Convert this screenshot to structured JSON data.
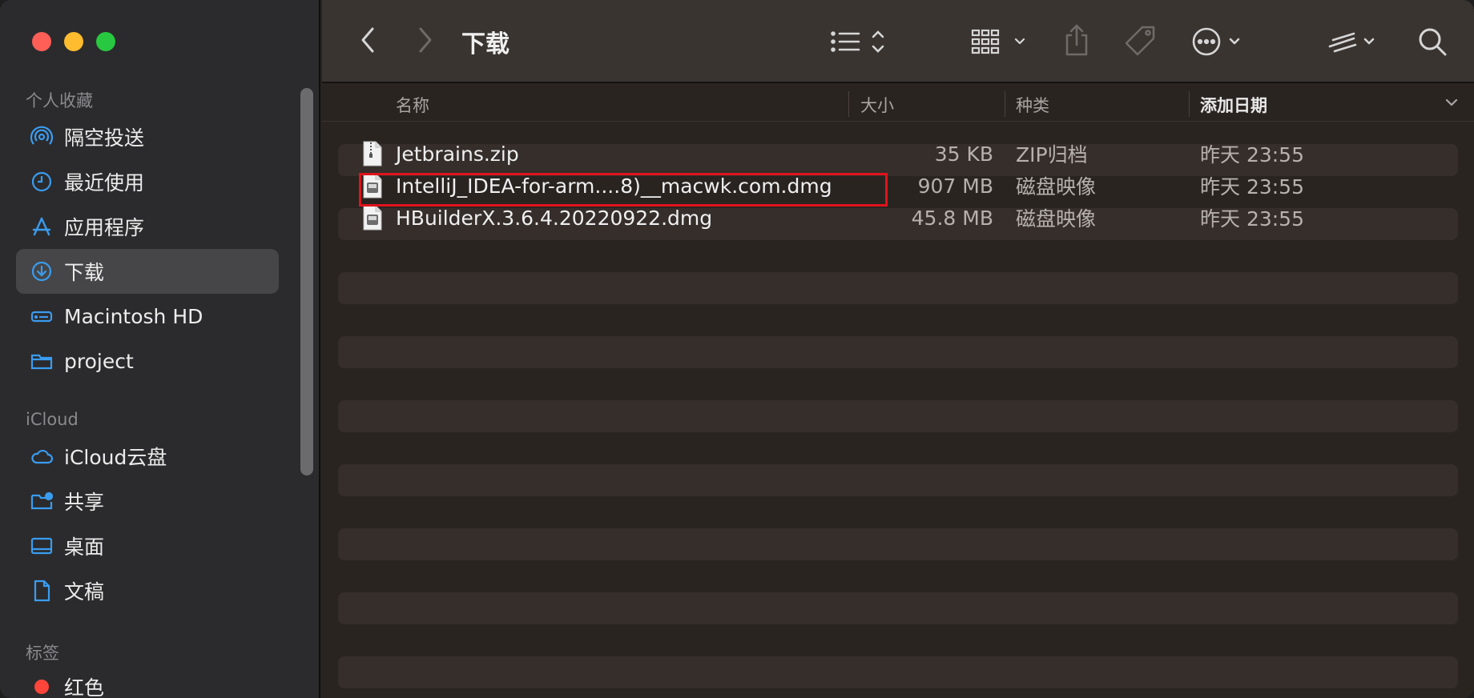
{
  "window": {
    "title": "下载"
  },
  "toolbar": {
    "back_icon": "chevron-left-icon",
    "forward_icon": "chevron-right-icon",
    "view_icon": "list-view-icon",
    "group_icon": "grid-group-icon",
    "share_icon": "share-icon",
    "tag_icon": "tag-icon",
    "more_icon": "ellipsis-circle-icon",
    "extension_icon": "extension-icon",
    "search_icon": "search-icon"
  },
  "sidebar": {
    "favorites_header": "个人收藏",
    "favorites": [
      {
        "label": "隔空投送",
        "icon": "airdrop-icon"
      },
      {
        "label": "最近使用",
        "icon": "clock-icon"
      },
      {
        "label": "应用程序",
        "icon": "applications-icon"
      },
      {
        "label": "下载",
        "icon": "download-icon",
        "active": true
      },
      {
        "label": "Macintosh HD",
        "icon": "hard-drive-icon"
      },
      {
        "label": "project",
        "icon": "folder-icon"
      }
    ],
    "icloud_header": "iCloud",
    "icloud": [
      {
        "label": "iCloud云盘",
        "icon": "cloud-icon"
      },
      {
        "label": "共享",
        "icon": "shared-folder-icon"
      },
      {
        "label": "桌面",
        "icon": "desktop-icon"
      },
      {
        "label": "文稿",
        "icon": "document-icon"
      }
    ],
    "tags_header": "标签",
    "tags": [
      {
        "label": "红色",
        "color": "#ff453a"
      }
    ]
  },
  "columns": {
    "name": "名称",
    "size": "大小",
    "kind": "种类",
    "date": "添加日期"
  },
  "files": [
    {
      "name": "Jetbrains.zip",
      "size": "35 KB",
      "kind": "ZIP归档",
      "date": "昨天 23:55",
      "icon": "zip-file-icon"
    },
    {
      "name": "IntelliJ_IDEA-for-arm....8)__macwk.com.dmg",
      "size": "907 MB",
      "kind": "磁盘映像",
      "date": "昨天 23:55",
      "icon": "disk-image-icon"
    },
    {
      "name": "HBuilderX.3.6.4.20220922.dmg",
      "size": "45.8 MB",
      "kind": "磁盘映像",
      "date": "昨天 23:55",
      "icon": "disk-image-icon"
    }
  ],
  "colors": {
    "highlight": "#e0131b",
    "sidebar_accent": "#3a9cf0",
    "tag_red": "#ff453a"
  }
}
